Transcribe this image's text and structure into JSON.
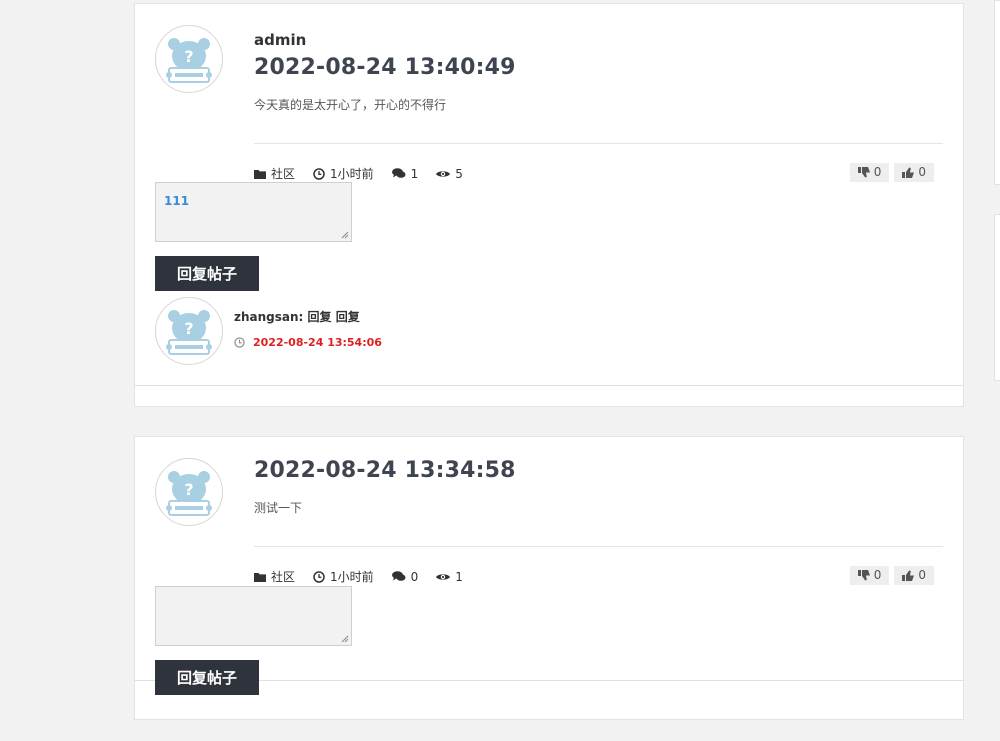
{
  "posts": [
    {
      "author": "admin",
      "title": "2022-08-24 13:40:49",
      "content": "今天真的是太开心了，开心的不得行",
      "category": "社区",
      "time": "1小时前",
      "comments": "1",
      "views": "5",
      "dislikes": "0",
      "likes": "0",
      "reply_value": "111",
      "reply_button": "回复帖子",
      "replies": [
        {
          "author_line": "zhangsan: 回复 回复",
          "time": "2022-08-24 13:54:06"
        }
      ]
    },
    {
      "author": "",
      "title": "2022-08-24 13:34:58",
      "content": "测试一下",
      "category": "社区",
      "time": "1小时前",
      "comments": "0",
      "views": "1",
      "dislikes": "0",
      "likes": "0",
      "reply_value": "",
      "reply_button": "回复帖子"
    }
  ],
  "icons": [
    "folder-icon",
    "clock-icon",
    "comments-icon",
    "eye-icon",
    "thumbs-down-icon",
    "thumbs-up-icon",
    "avatar-placeholder-icon"
  ]
}
